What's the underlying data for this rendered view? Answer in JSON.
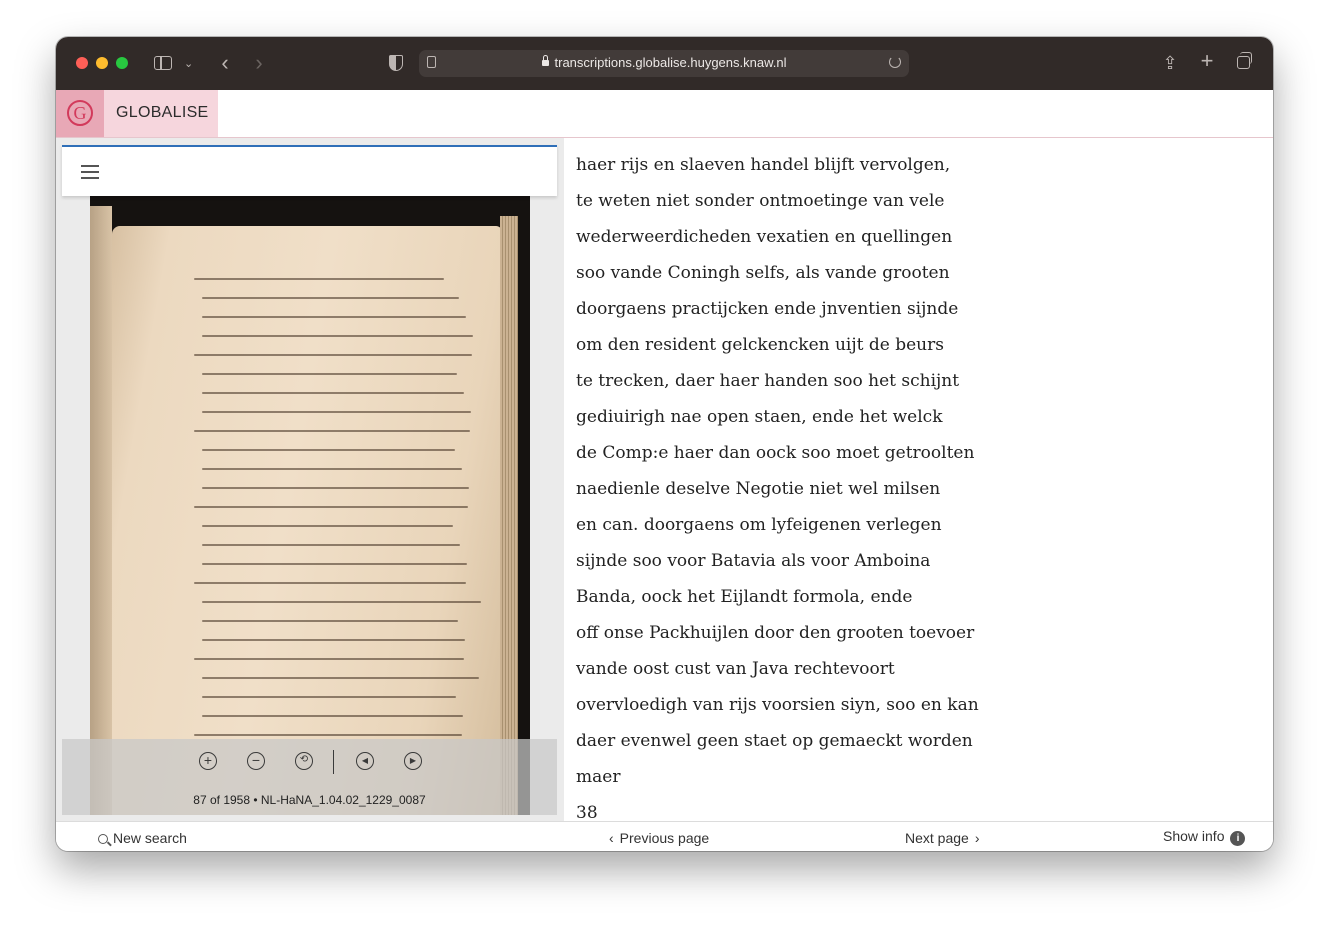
{
  "browser": {
    "url": "transcriptions.globalise.huygens.knaw.nl"
  },
  "app": {
    "brand": "GLOBALISE",
    "logo_letter": "G"
  },
  "viewer": {
    "page_count": "87 of 1958 • NL-HaNA_1.04.02_1229_0087",
    "icons": [
      "zoom-in-icon",
      "zoom-out-icon",
      "reset-zoom-icon",
      "previous-icon",
      "next-icon"
    ]
  },
  "transcription": {
    "lines": [
      "haer rijs en slaeven handel blijft vervolgen,",
      "te weten niet sonder ontmoetinge van vele",
      "wederweerdicheden vexatien en quellingen",
      "soo vande Coningh selfs, als vande grooten",
      "doorgaens practijcken ende jnventien sijnde",
      "om den resident gelckencken uijt de beurs",
      "te trecken, daer haer handen soo het schijnt",
      "gediuirigh nae open staen, ende het welck",
      "de Comp:e haer dan oock soo moet getroolten",
      "naedienle deselve Negotie niet wel milsen",
      "en can. doorgaens om lyfeigenen verlegen",
      "sijnde soo voor Batavia als voor Amboina",
      "Banda, oock het Eijlandt formola, ende",
      "off onse Packhuijlen door den grooten toevoer",
      "vande oost cust van Java rechtevoort",
      "overvloedigh van rijs voorsien siyn, soo en kan",
      "daer evenwel geen staet op gemaeckt worden",
      "maer",
      "38"
    ]
  },
  "bottom_bar": {
    "new_search": "New search",
    "previous_page": "Previous page",
    "next_page": "Next page",
    "show_info": "Show info",
    "info_glyph": "i"
  },
  "colors": {
    "accent_blue": "#2f6fb8",
    "brand_pink": "#e8a8b6",
    "brand_red": "#d23a5b"
  }
}
